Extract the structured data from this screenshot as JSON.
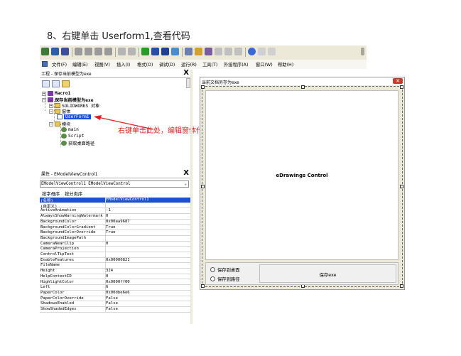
{
  "doc": {
    "heading": "8、右键单击 Userform1,查看代码"
  },
  "menu": {
    "items": [
      "文件(F)",
      "编辑(E)",
      "视图(V)",
      "插入(I)",
      "格式(O)",
      "调试(D)",
      "运行(R)",
      "工具(T)",
      "外接程序(A)",
      "窗口(W)",
      "帮助(H)"
    ]
  },
  "project": {
    "title": "工程 - 保存当前模型为exe",
    "close_glyph": "X",
    "tree": {
      "macro": "Macro1",
      "project": "保存当前模型为exe",
      "solidworks": "SOLIDWORKS 对象",
      "forms": "窗体",
      "userform": "UserForm1",
      "modules": "模块",
      "mod_main": "main",
      "mod_script": "Script",
      "mod_desktop": "获取桌面路径"
    }
  },
  "annotation": "右键单击此处，编辑窗体代码",
  "properties": {
    "title": "属性 - EModelViewControl1",
    "close_glyph": "X",
    "object": "EModelViewControl1 EModelViewControl",
    "tabs": [
      "按字母序",
      "按分类序"
    ],
    "rows": [
      {
        "k": "(名称)",
        "v": "EModelViewControl1"
      },
      {
        "k": "(自定义)",
        "v": ""
      },
      {
        "k": "ActiveAnimation",
        "v": "-1"
      },
      {
        "k": "AlwaysShowWarningWatermark",
        "v": "0"
      },
      {
        "k": "BackgroundColor",
        "v": "0x00aa9687"
      },
      {
        "k": "BackgroundColorGradient",
        "v": "True"
      },
      {
        "k": "BackgroundColorOverride",
        "v": "True"
      },
      {
        "k": "BackgroundImagePath",
        "v": ""
      },
      {
        "k": "CameraNearClip",
        "v": "0"
      },
      {
        "k": "CameraProjection",
        "v": ""
      },
      {
        "k": "ControlTipText",
        "v": ""
      },
      {
        "k": "EnableFeatures",
        "v": "0x00000821"
      },
      {
        "k": "FileName",
        "v": ""
      },
      {
        "k": "Height",
        "v": "324"
      },
      {
        "k": "HelpContextID",
        "v": "0"
      },
      {
        "k": "HighlightColor",
        "v": "0x0000ff00"
      },
      {
        "k": "Left",
        "v": "6"
      },
      {
        "k": "PaperColor",
        "v": "0x00dbe6e6"
      },
      {
        "k": "PaperColorOverride",
        "v": "False"
      },
      {
        "k": "ShadowsEnabled",
        "v": "False"
      },
      {
        "k": "ShowShadedEdges",
        "v": "False"
      }
    ]
  },
  "form": {
    "caption": "当前文档另存为exe",
    "close_glyph": "✕",
    "control_label": "eDrawings Control",
    "radio_desktop": "保存到桌面",
    "radio_path": "保存到路径",
    "save_button": "保存exe"
  },
  "colors": {
    "selection": "#1b4fd6",
    "annotation": "#e02020",
    "window_bg": "#ece9d8"
  }
}
